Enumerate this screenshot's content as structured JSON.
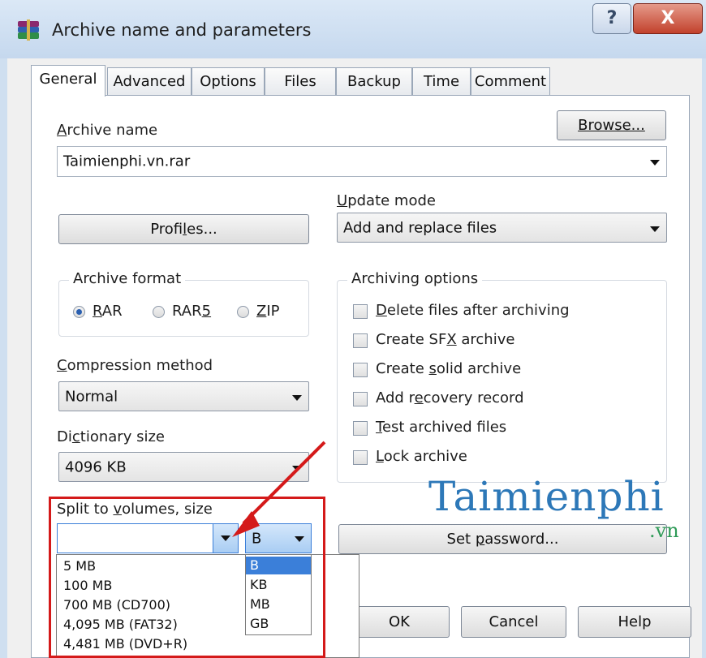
{
  "window": {
    "title": "Archive name and parameters",
    "help_label": "?",
    "close_label": "X"
  },
  "tabs": [
    {
      "label": "General"
    },
    {
      "label": "Advanced"
    },
    {
      "label": "Options"
    },
    {
      "label": "Files"
    },
    {
      "label": "Backup"
    },
    {
      "label": "Time"
    },
    {
      "label": "Comment"
    }
  ],
  "archive_name": {
    "label_a": "A",
    "label_rest": "rchive name",
    "value": "Taimienphi.vn.rar",
    "browse_label": "Browse..."
  },
  "update_mode": {
    "label_u": "U",
    "label_rest": "pdate mode",
    "value": "Add and replace files"
  },
  "profiles": {
    "pre": "Profi",
    "u": "l",
    "post": "es..."
  },
  "archive_format": {
    "title": "Archive format",
    "options": [
      {
        "pre": "",
        "u": "R",
        "post": "AR",
        "selected": true
      },
      {
        "pre": "RAR",
        "u": "5",
        "post": "",
        "selected": false
      },
      {
        "pre": "",
        "u": "Z",
        "post": "IP",
        "selected": false
      }
    ]
  },
  "archiving_options": {
    "title": "Archiving options",
    "items": [
      {
        "pre": "",
        "u": "D",
        "post": "elete files after archiving"
      },
      {
        "pre": "Create SF",
        "u": "X",
        "post": " archive"
      },
      {
        "pre": "Create ",
        "u": "s",
        "post": "olid archive"
      },
      {
        "pre": "Add r",
        "u": "e",
        "post": "covery record"
      },
      {
        "pre": "",
        "u": "T",
        "post": "est archived files"
      },
      {
        "pre": "",
        "u": "L",
        "post": "ock archive"
      }
    ]
  },
  "compression": {
    "pre": "",
    "u": "C",
    "post": "ompression method",
    "value": "Normal"
  },
  "dictionary": {
    "pre": "Di",
    "u": "c",
    "post": "tionary size",
    "value": "4096 KB"
  },
  "split": {
    "pre": "Split to ",
    "u": "v",
    "post": "olumes, size",
    "value": "",
    "unit_value": "B",
    "size_options": [
      "5 MB",
      "100 MB",
      "700 MB  (CD700)",
      "4,095 MB  (FAT32)",
      "4,481 MB  (DVD+R)"
    ],
    "unit_options": [
      "B",
      "KB",
      "MB",
      "GB"
    ],
    "selected_unit": "B"
  },
  "set_password": {
    "pre": "Set ",
    "u": "p",
    "post": "assword..."
  },
  "bottom_buttons": {
    "ok": "OK",
    "cancel": "Cancel",
    "help": "Help"
  },
  "watermark": {
    "main": "Taimienphi",
    "sub": ".vn"
  },
  "colors": {
    "highlight": "#d41a1a",
    "selection": "#3b7fd9",
    "watermark": "#2d78b8"
  }
}
